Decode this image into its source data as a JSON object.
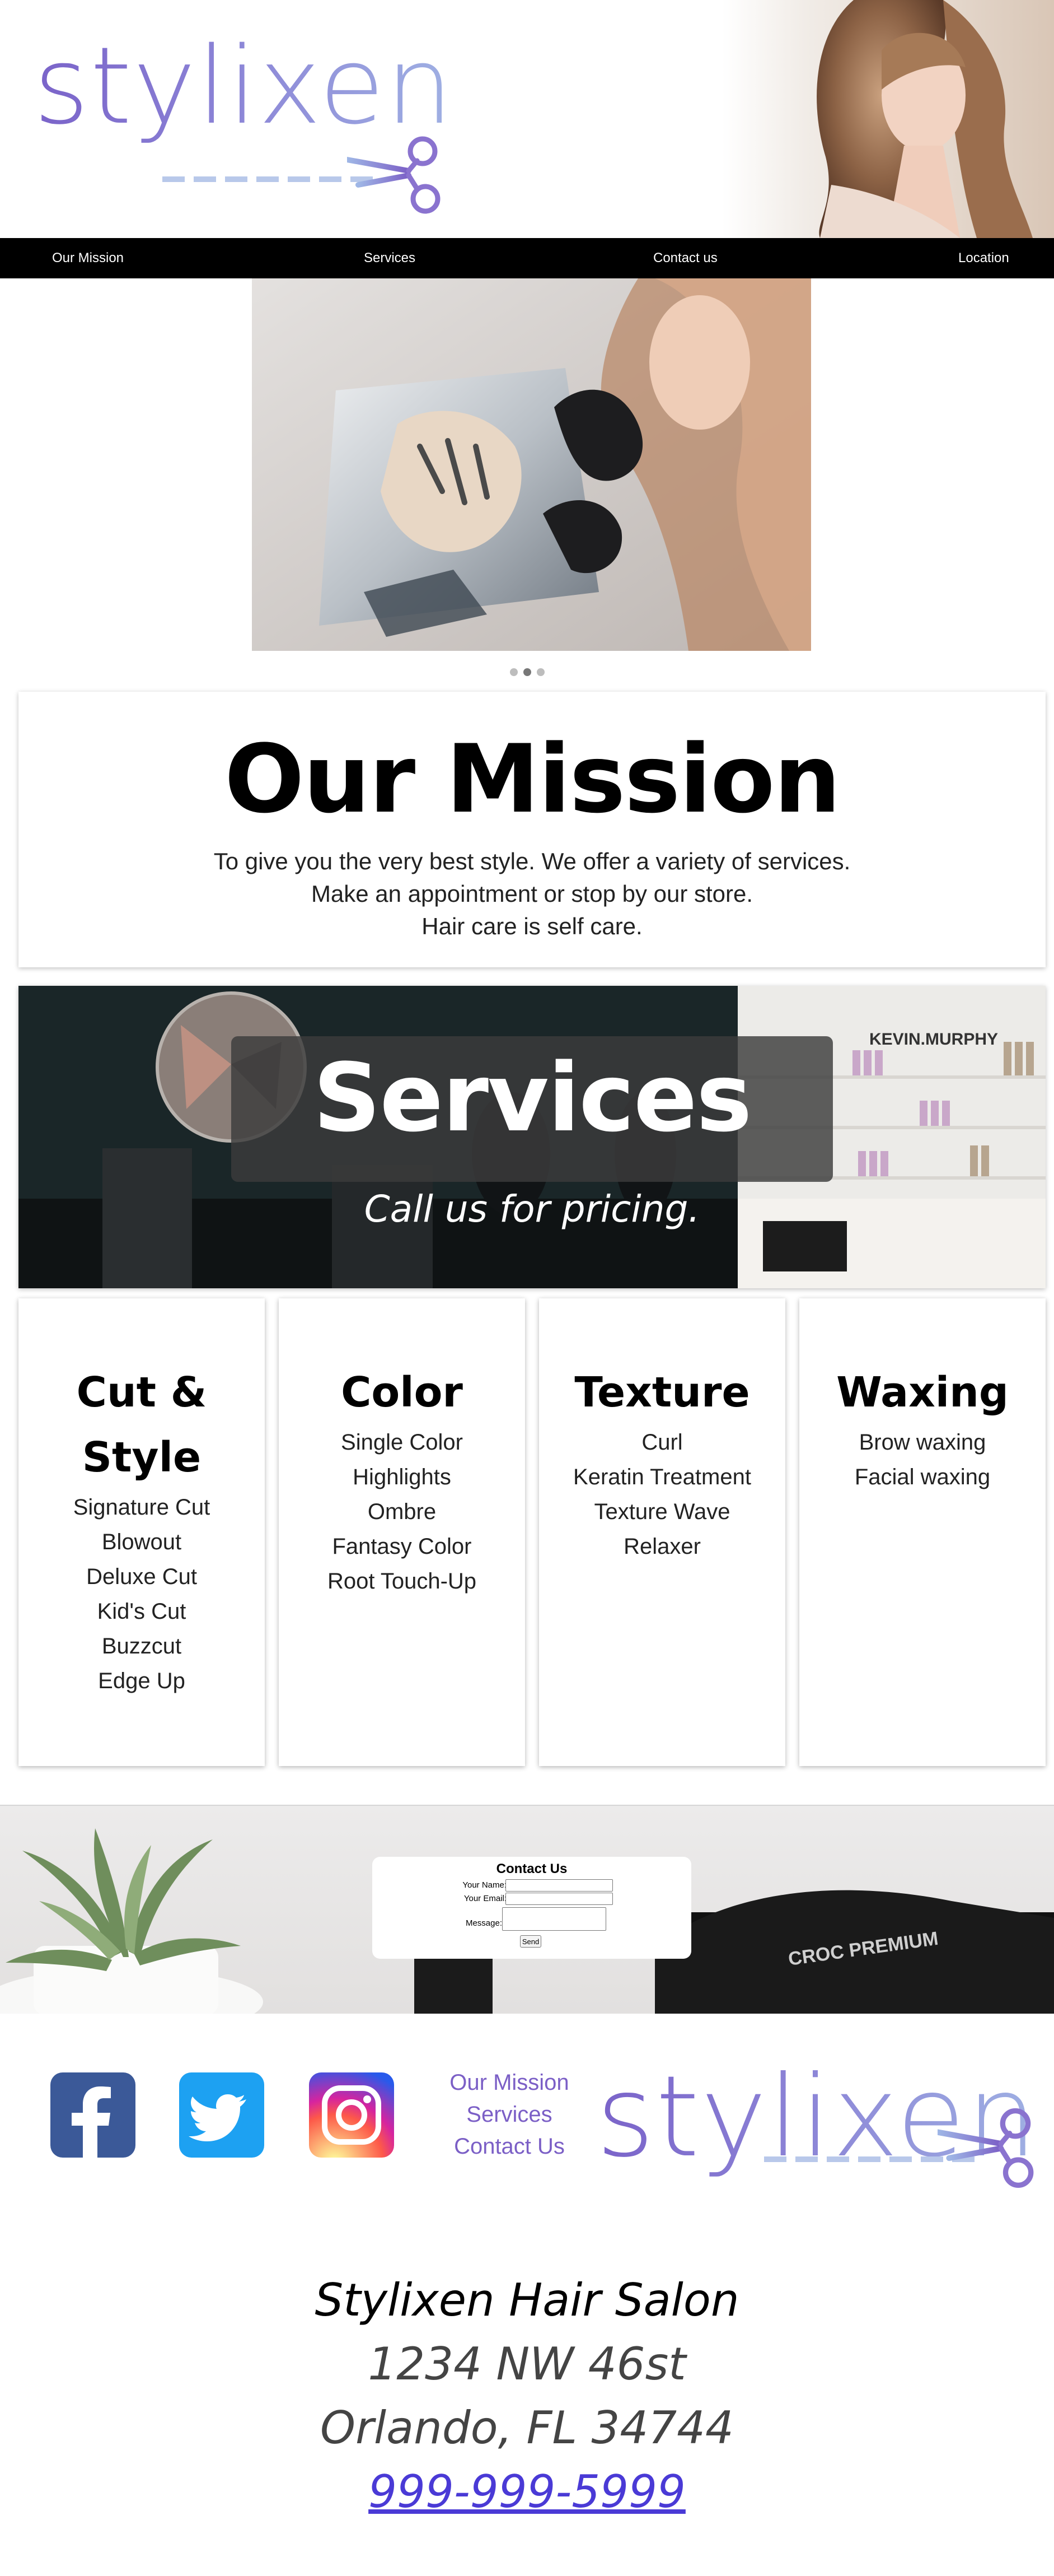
{
  "brand": {
    "logo_text": "stylixen"
  },
  "nav": {
    "items": [
      {
        "label": "Our Mission"
      },
      {
        "label": "Services"
      },
      {
        "label": "Contact us"
      },
      {
        "label": "Location"
      }
    ]
  },
  "carousel": {
    "slide_count": 3,
    "active_index": 1
  },
  "mission": {
    "title": "Our Mission",
    "lines": [
      "To give you the very best style. We offer a variety of services.",
      "Make an appointment or stop by our store.",
      "Hair care is self care."
    ]
  },
  "services_banner": {
    "title": "Services",
    "subtitle": "Call us for pricing.",
    "shelf_brand": "KEVIN.MURPHY"
  },
  "service_cards": [
    {
      "title": "Cut & Style",
      "items": [
        "Signature Cut",
        "Blowout",
        "Deluxe Cut",
        "Kid's Cut",
        "Buzzcut",
        "Edge Up"
      ]
    },
    {
      "title": "Color",
      "items": [
        "Single Color",
        "Highlights",
        "Ombre",
        "Fantasy Color",
        "Root Touch-Up"
      ]
    },
    {
      "title": "Texture",
      "items": [
        "Curl",
        "Keratin Treatment",
        "Texture Wave",
        "Relaxer"
      ]
    },
    {
      "title": "Waxing",
      "items": [
        "Brow waxing",
        "Facial waxing"
      ]
    }
  ],
  "contact": {
    "title": "Contact Us",
    "name_label": "Your Name:",
    "email_label": "Your Email:",
    "message_label": "Message:",
    "send_label": "Send",
    "name_value": "",
    "email_value": "",
    "message_value": "",
    "dryer_brand": "CROC PREMIUM"
  },
  "footer": {
    "social": [
      {
        "name": "facebook",
        "icon": "facebook-icon"
      },
      {
        "name": "twitter",
        "icon": "twitter-icon"
      },
      {
        "name": "instagram",
        "icon": "instagram-icon"
      }
    ],
    "links": [
      "Our Mission",
      "Services",
      "Contact Us"
    ],
    "address": {
      "name": "Stylixen Hair Salon",
      "street": "1234 NW 46st",
      "city": "Orlando, FL 34744",
      "phone": "999-999-5999"
    }
  },
  "colors": {
    "nav_bg": "#000000",
    "brand_purple": "#7a63c9",
    "link_purple": "#7b5fc6",
    "phone_link": "#4a3ad6"
  }
}
